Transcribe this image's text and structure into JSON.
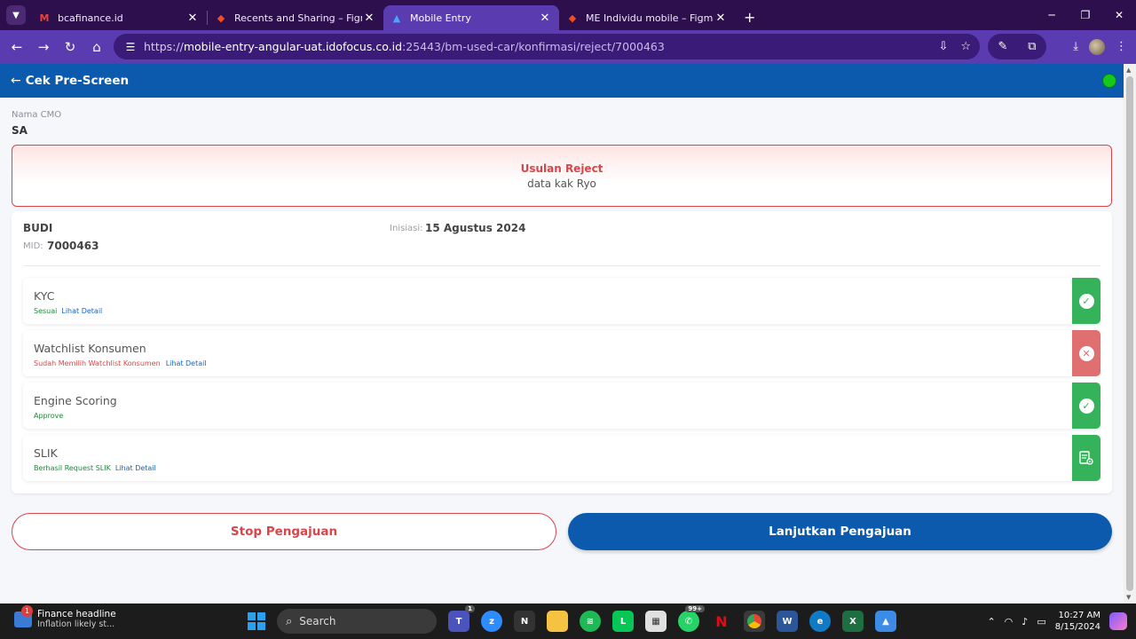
{
  "browser": {
    "tabs": [
      {
        "title": "bcafinance.id",
        "icon": "gmail-icon",
        "active": false
      },
      {
        "title": "Recents and Sharing – Figma",
        "icon": "figma-icon",
        "active": false
      },
      {
        "title": "Mobile Entry",
        "icon": "app-icon",
        "active": true
      },
      {
        "title": "ME Individu mobile – Figma",
        "icon": "figma-icon",
        "active": false
      }
    ],
    "url_prefix": "https://",
    "url_host": "mobile-entry-angular-uat.idofocus.co.id",
    "url_rest": ":25443/bm-used-car/konfirmasi/reject/7000463"
  },
  "header": {
    "title": "Cek Pre-Screen",
    "status_color": "#14c81e"
  },
  "cmo": {
    "label": "Nama CMO",
    "value": "SA"
  },
  "reject": {
    "title": "Usulan Reject",
    "note": "data kak Ryo"
  },
  "customer": {
    "name": "BUDI",
    "mid_label": "MID:",
    "mid_value": "7000463",
    "inisiasi_label": "Inisiasi:",
    "inisiasi_value": "15 Agustus 2024"
  },
  "checks": [
    {
      "label": "KYC",
      "status": "Sesuai",
      "status_type": "ok",
      "link": "Lihat Detail",
      "icon": "check-icon"
    },
    {
      "label": "Watchlist Konsumen",
      "status": "Sudah Memilih Watchlist Konsumen",
      "status_type": "fail",
      "link": "Lihat Detail",
      "icon": "close-icon"
    },
    {
      "label": "Engine Scoring",
      "status": "Approve",
      "status_type": "ok",
      "link": "",
      "icon": "check-icon"
    },
    {
      "label": "SLIK",
      "status": "Berhasil Request SLIK",
      "status_type": "ok",
      "link": "Lihat Detail",
      "icon": "document-view-icon"
    }
  ],
  "actions": {
    "stop": "Stop Pengajuan",
    "next": "Lanjutkan Pengajuan"
  },
  "taskbar": {
    "news_title": "Finance headline",
    "news_sub": "Inflation likely st...",
    "news_badge": "1",
    "search_label": "Search",
    "teams_badge": "1",
    "whatsapp_badge": "99+",
    "time": "10:27 AM",
    "date": "8/15/2024"
  },
  "colors": {
    "primary": "#0c5aad",
    "danger": "#d9464a",
    "success": "#35b35a"
  }
}
